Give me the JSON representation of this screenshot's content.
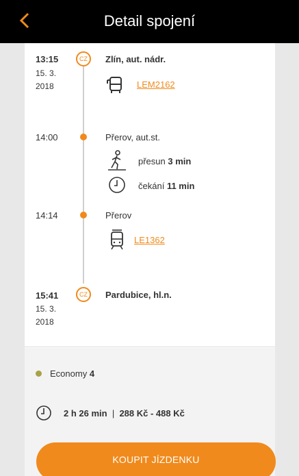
{
  "header": {
    "title": "Detail spojení",
    "back_icon": "chevron-left-icon"
  },
  "colors": {
    "accent": "#f08a1c",
    "economy_dot": "#a8a24a"
  },
  "stops": [
    {
      "time": "13:15",
      "date_line1": "15. 3.",
      "date_line2": "2018",
      "marker": "CZ",
      "name": "Zlín, aut. nádr."
    },
    {
      "time": "14:00",
      "name": "Přerov, aut.st."
    },
    {
      "time": "14:14",
      "name": "Přerov"
    },
    {
      "time": "15:41",
      "date_line1": "15. 3.",
      "date_line2": "2018",
      "marker": "CZ",
      "name": "Pardubice, hl.n."
    }
  ],
  "legs": {
    "bus": {
      "icon": "bus-icon",
      "label": "LEM2162"
    },
    "transfer": {
      "icon": "walking-icon",
      "prefix": "přesun",
      "value": "3 min"
    },
    "wait": {
      "icon": "clock-icon",
      "prefix": "čekání",
      "value": "11 min"
    },
    "train": {
      "icon": "train-icon",
      "label": "LE1362"
    }
  },
  "summary": {
    "class_name": "Economy",
    "class_count": "4",
    "duration": "2 h 26 min",
    "separator": "|",
    "price": "288 Kč - 488 Kč"
  },
  "buy_button": {
    "label": "KOUPIT JÍZDENKU"
  }
}
